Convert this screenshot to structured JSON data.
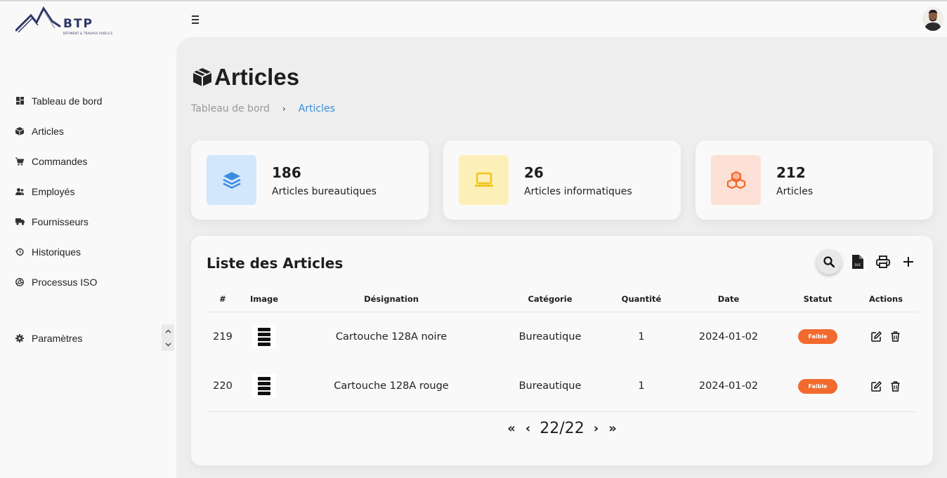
{
  "brand": {
    "name": "BTP",
    "tagline": "BÂTIMENT & TRAVAUX PUBLICS"
  },
  "sidebar": {
    "items": [
      {
        "label": "Tableau de bord",
        "icon": "dashboard-icon"
      },
      {
        "label": "Articles",
        "icon": "box-icon"
      },
      {
        "label": "Commandes",
        "icon": "cart-icon"
      },
      {
        "label": "Employés",
        "icon": "users-icon"
      },
      {
        "label": "Fournisseurs",
        "icon": "truck-icon"
      },
      {
        "label": "Historiques",
        "icon": "history-icon"
      },
      {
        "label": "Processus ISO",
        "icon": "aperture-icon"
      }
    ],
    "settings_label": "Paramètres"
  },
  "page": {
    "title": "Articles",
    "breadcrumb": {
      "home": "Tableau de bord",
      "separator": "›",
      "current": "Articles"
    }
  },
  "stats": [
    {
      "value": "186",
      "label": "Articles bureautiques",
      "icon": "layers-icon",
      "tile_color": "#d2e6fc",
      "icon_color": "#3d8be0"
    },
    {
      "value": "26",
      "label": "Articles informatiques",
      "icon": "laptop-icon",
      "tile_color": "#fdefb8",
      "icon_color": "#f3c319"
    },
    {
      "value": "212",
      "label": "Articles",
      "icon": "boxes-icon",
      "tile_color": "#fde0d6",
      "icon_color": "#f26a2e"
    }
  ],
  "list": {
    "title": "Liste des Articles",
    "columns": [
      "#",
      "Image",
      "Désignation",
      "Catégorie",
      "Quantité",
      "Date",
      "Statut",
      "Actions"
    ],
    "rows": [
      {
        "id": "219",
        "designation": "Cartouche 128A noire",
        "categorie": "Bureautique",
        "quantite": "1",
        "date": "2024-01-02",
        "statut": "Faible"
      },
      {
        "id": "220",
        "designation": "Cartouche 128A rouge",
        "categorie": "Bureautique",
        "quantite": "1",
        "date": "2024-01-02",
        "statut": "Faible"
      }
    ],
    "pagination": {
      "first": "«",
      "prev": "‹",
      "text": "22/22",
      "next": "›",
      "last": "»"
    }
  },
  "colors": {
    "accent": "#3b8edc",
    "badge": "#f26a2e"
  }
}
